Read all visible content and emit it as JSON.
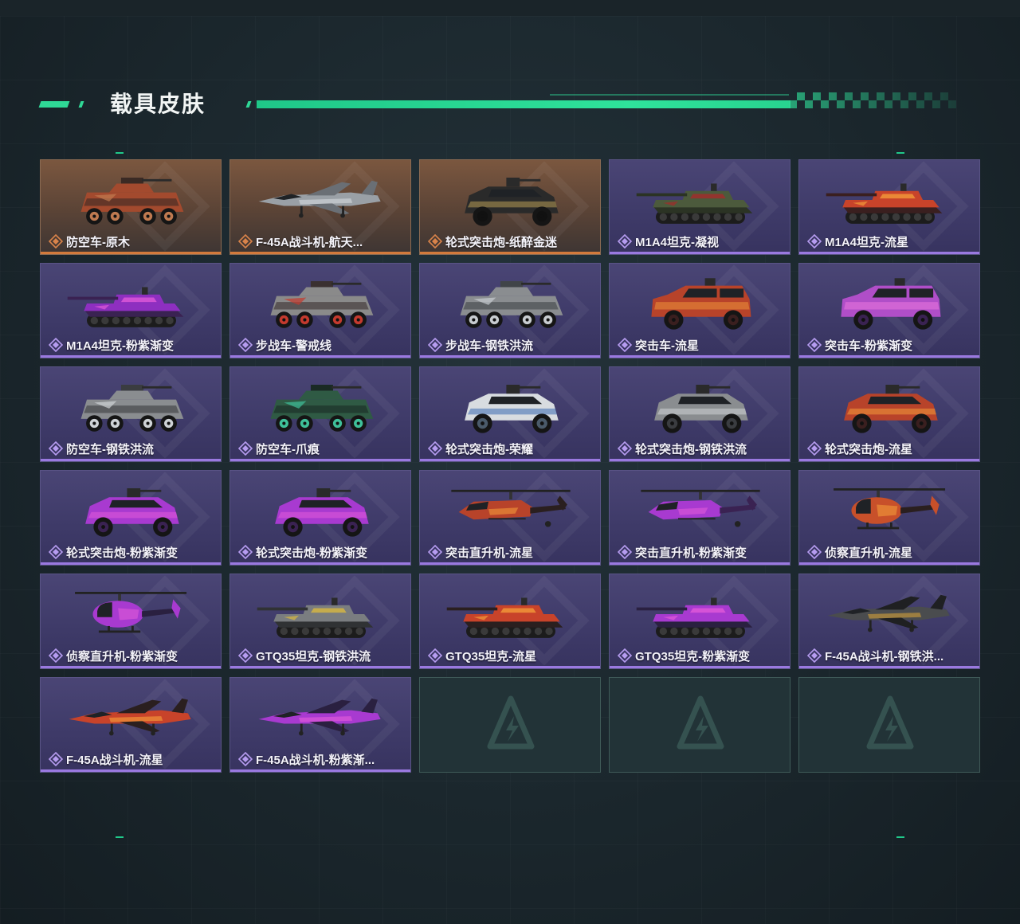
{
  "header": {
    "title": "载具皮肤"
  },
  "colors": {
    "accent": "#2fd896",
    "rare_border": "#d37a3c",
    "epic_border": "#9a79e0",
    "card_epic_bg": "#3e3a68",
    "card_rare_bg": "#5a4336",
    "empty_slot_bg": "#223337"
  },
  "skins": [
    {
      "name": "防空车-原木",
      "rarity": "rare",
      "vehicle": "wheeled-apc",
      "colors": [
        "#a34a2e",
        "#3a2a24",
        "#c07a50"
      ]
    },
    {
      "name": "F-45A战斗机-航天...",
      "rarity": "rare",
      "vehicle": "jet",
      "colors": [
        "#9aa0a6",
        "#6a6f75",
        "#d0d4d8"
      ]
    },
    {
      "name": "轮式突击炮-纸醉金迷",
      "rarity": "rare",
      "vehicle": "armored-car",
      "colors": [
        "#2a2a2a",
        "#111111",
        "#b79a54"
      ]
    },
    {
      "name": "M1A4坦克-凝视",
      "rarity": "epic",
      "vehicle": "tank",
      "colors": [
        "#4c5a3c",
        "#2b3324",
        "#a52a2a"
      ]
    },
    {
      "name": "M1A4坦克-流星",
      "rarity": "epic",
      "vehicle": "tank",
      "colors": [
        "#c8432a",
        "#3a1f1f",
        "#f29a3a"
      ]
    },
    {
      "name": "M1A4坦克-粉紫渐变",
      "rarity": "epic",
      "vehicle": "tank",
      "colors": [
        "#8e2fc0",
        "#3a2252",
        "#e05ad8"
      ]
    },
    {
      "name": "步战车-警戒线",
      "rarity": "epic",
      "vehicle": "wheeled-apc",
      "colors": [
        "#8a8a8a",
        "#3a3030",
        "#c43a2e"
      ]
    },
    {
      "name": "步战车-钢铁洪流",
      "rarity": "epic",
      "vehicle": "wheeled-apc",
      "colors": [
        "#8a8d90",
        "#404448",
        "#c8ccd0"
      ]
    },
    {
      "name": "突击车-流星",
      "rarity": "epic",
      "vehicle": "truck",
      "colors": [
        "#b8432a",
        "#3a1f1f",
        "#f29a3a"
      ]
    },
    {
      "name": "突击车-粉紫渐变",
      "rarity": "epic",
      "vehicle": "truck",
      "colors": [
        "#b04ec8",
        "#3a2252",
        "#f07ae0"
      ]
    },
    {
      "name": "防空车-钢铁洪流",
      "rarity": "epic",
      "vehicle": "wheeled-apc",
      "colors": [
        "#8a8d90",
        "#3a3c40",
        "#cfd3d6"
      ]
    },
    {
      "name": "防空车-爪痕",
      "rarity": "epic",
      "vehicle": "wheeled-apc",
      "colors": [
        "#2f5a44",
        "#1a2a24",
        "#3fc09a"
      ]
    },
    {
      "name": "轮式突击炮-荣耀",
      "rarity": "epic",
      "vehicle": "armored-car",
      "colors": [
        "#d8dce0",
        "#4a5a6a",
        "#3a6ab0"
      ]
    },
    {
      "name": "轮式突击炮-钢铁洪流",
      "rarity": "epic",
      "vehicle": "armored-car",
      "colors": [
        "#8a8d90",
        "#3a3c40",
        "#cfd3d6"
      ]
    },
    {
      "name": "轮式突击炮-流星",
      "rarity": "epic",
      "vehicle": "armored-car",
      "colors": [
        "#b8432a",
        "#3a1f1f",
        "#f29a3a"
      ]
    },
    {
      "name": "轮式突击炮-粉紫渐变",
      "rarity": "epic",
      "vehicle": "armored-car",
      "colors": [
        "#a83ad0",
        "#3a2252",
        "#e05ad8"
      ]
    },
    {
      "name": "轮式突击炮-粉紫渐变",
      "rarity": "epic",
      "vehicle": "armored-car",
      "colors": [
        "#a83ad0",
        "#3a2252",
        "#e05ad8"
      ]
    },
    {
      "name": "突击直升机-流星",
      "rarity": "epic",
      "vehicle": "attack-heli",
      "colors": [
        "#b8432a",
        "#2a1f1f",
        "#f29a3a"
      ]
    },
    {
      "name": "突击直升机-粉紫渐变",
      "rarity": "epic",
      "vehicle": "attack-heli",
      "colors": [
        "#a83ad0",
        "#3a2252",
        "#e05ad8"
      ]
    },
    {
      "name": "侦察直升机-流星",
      "rarity": "epic",
      "vehicle": "scout-heli",
      "colors": [
        "#c8502a",
        "#2a1f1f",
        "#f29a3a"
      ]
    },
    {
      "name": "侦察直升机-粉紫渐变",
      "rarity": "epic",
      "vehicle": "scout-heli",
      "colors": [
        "#a83ad0",
        "#2a2040",
        "#e05ad8"
      ]
    },
    {
      "name": "GTQ35坦克-钢铁洪流",
      "rarity": "epic",
      "vehicle": "tank",
      "colors": [
        "#7a7d80",
        "#303234",
        "#d8b840"
      ]
    },
    {
      "name": "GTQ35坦克-流星",
      "rarity": "epic",
      "vehicle": "tank",
      "colors": [
        "#c8432a",
        "#2a1f1f",
        "#f29a3a"
      ]
    },
    {
      "name": "GTQ35坦克-粉紫渐变",
      "rarity": "epic",
      "vehicle": "tank",
      "colors": [
        "#a83ad0",
        "#2a2040",
        "#e05ad8"
      ]
    },
    {
      "name": "F-45A战斗机-钢铁洪...",
      "rarity": "epic",
      "vehicle": "jet",
      "colors": [
        "#4a4c4e",
        "#1f2022",
        "#c89a3a"
      ]
    },
    {
      "name": "F-45A战斗机-流星",
      "rarity": "epic",
      "vehicle": "jet",
      "colors": [
        "#c8432a",
        "#2a1f1f",
        "#f29a3a"
      ]
    },
    {
      "name": "F-45A战斗机-粉紫渐...",
      "rarity": "epic",
      "vehicle": "jet",
      "colors": [
        "#a83ad0",
        "#2a2040",
        "#e05ad8"
      ]
    },
    {
      "name": "",
      "rarity": "empty"
    },
    {
      "name": "",
      "rarity": "empty"
    },
    {
      "name": "",
      "rarity": "empty"
    }
  ]
}
